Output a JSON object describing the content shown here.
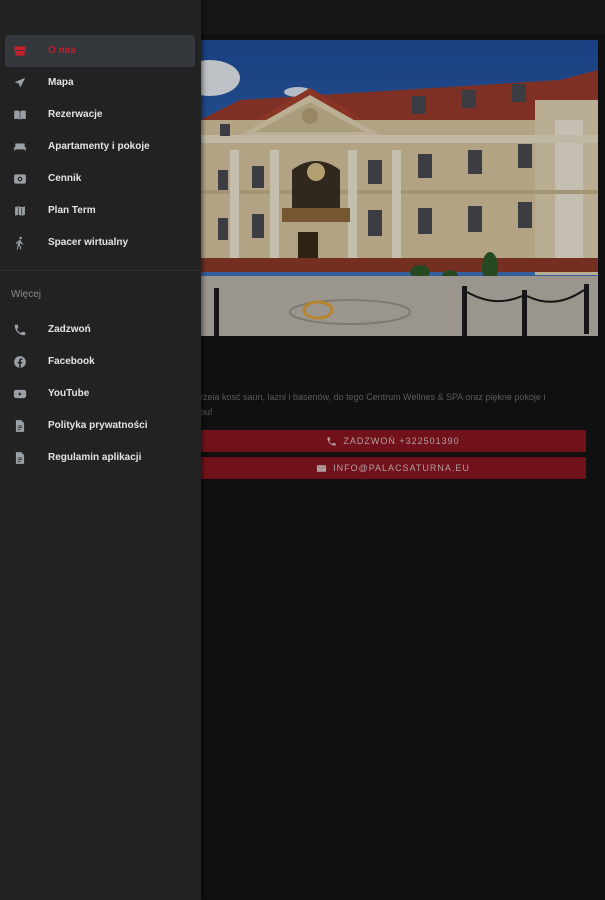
{
  "drawer": {
    "primary_items": [
      {
        "label": "O nas",
        "icon": "store-icon",
        "active": true
      },
      {
        "label": "Mapa",
        "icon": "navigation-arrow-icon",
        "active": false
      },
      {
        "label": "Rezerwacje",
        "icon": "book-icon",
        "active": false
      },
      {
        "label": "Apartamenty i pokoje",
        "icon": "bed-icon",
        "active": false
      },
      {
        "label": "Cennik",
        "icon": "price-tag-icon",
        "active": false
      },
      {
        "label": "Plan Term",
        "icon": "map-icon",
        "active": false
      },
      {
        "label": "Spacer wirtualny",
        "icon": "walking-person-icon",
        "active": false
      }
    ],
    "section_label": "Więcej",
    "secondary_items": [
      {
        "label": "Zadzwoń",
        "icon": "phone-icon"
      },
      {
        "label": "Facebook",
        "icon": "facebook-icon"
      },
      {
        "label": "YouTube",
        "icon": "youtube-icon"
      },
      {
        "label": "Polityka prywatności",
        "icon": "document-icon"
      },
      {
        "label": "Regulamin aplikacji",
        "icon": "document-icon"
      }
    ]
  },
  "main": {
    "intro_text": "rzeia kosć saun, lazni i basenów, do tego Centrum Wellnes & SPA oraz piękne pokoje i",
    "intro_text_2": "pu!",
    "call_button_label": "ZADZWOŃ +322501390",
    "email_button_label": "INFO@PALACSATURNA.EU"
  },
  "colors": {
    "accent": "#c1202c",
    "drawer_bg": "#222222",
    "active_item_bg": "#34373b",
    "button_bg": "#8a1720"
  }
}
